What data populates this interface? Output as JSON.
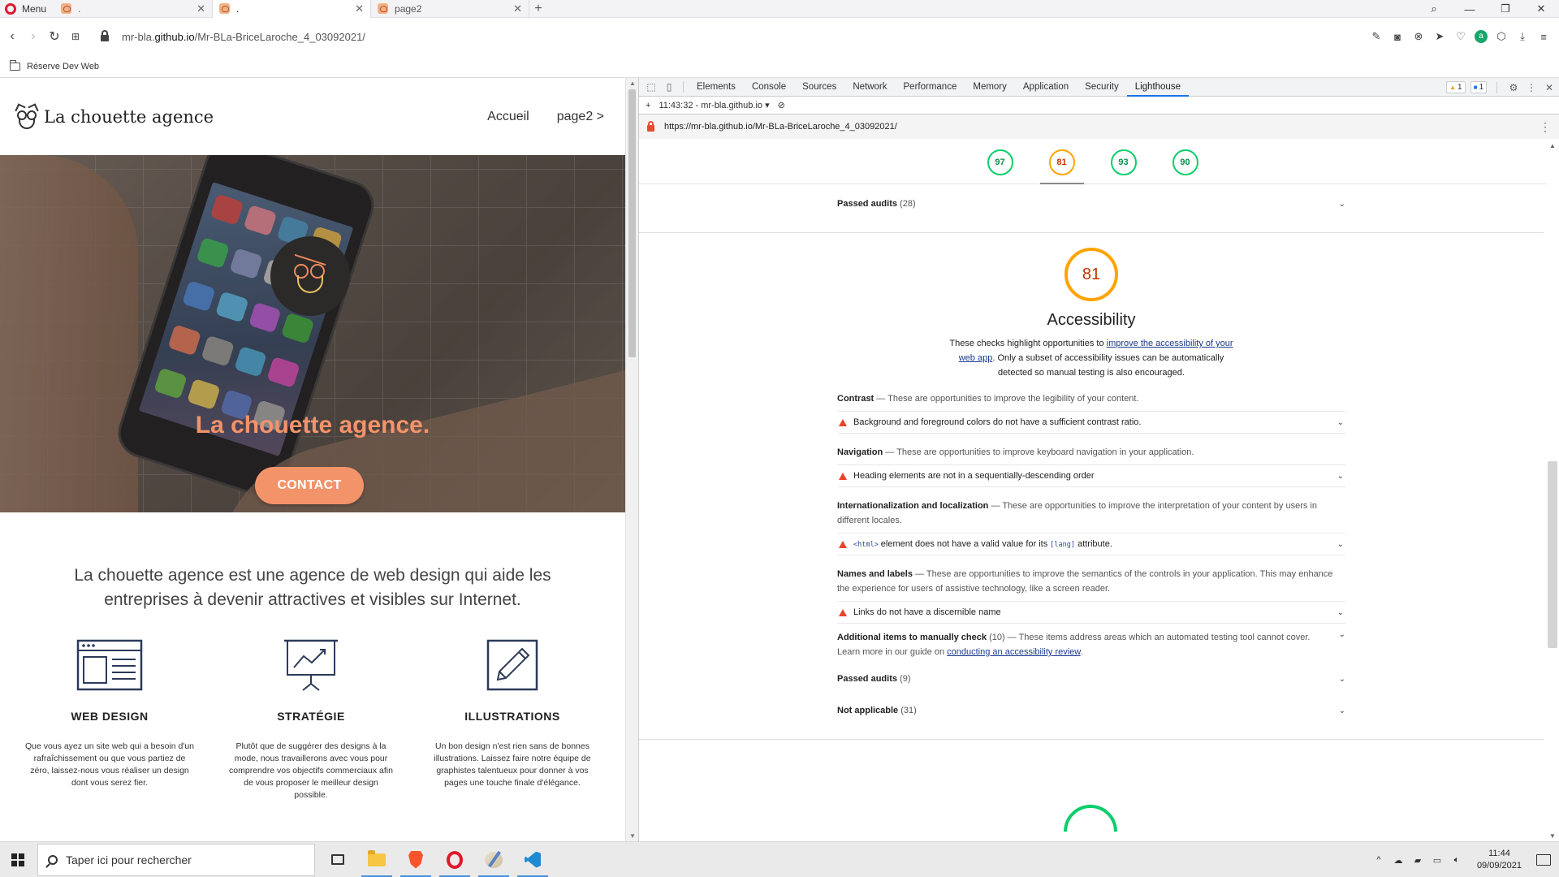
{
  "browser": {
    "menu_label": "Menu",
    "tabs": [
      {
        "title": ".",
        "active": false
      },
      {
        "title": ".",
        "active": true
      },
      {
        "title": "page2",
        "active": false
      }
    ],
    "new_tab": "+",
    "url_prefix": "mr-bla.",
    "url_domain": "github.io",
    "url_path": "/Mr-BLa-BriceLaroche_4_03092021/",
    "bookmark_folder": "Réserve Dev Web"
  },
  "site": {
    "logo_text": "La chouette agence",
    "nav": [
      "Accueil",
      "page2 >"
    ],
    "hero_title": "La chouette agence.",
    "contact_label": "CONTACT",
    "intro": "La chouette agence est une agence de web design qui aide les entreprises à devenir attractives et visibles sur Internet.",
    "services": [
      {
        "title": "WEB DESIGN",
        "text": "Que vous ayez un site web qui a besoin d'un rafraîchissement ou que vous partiez de zéro, laissez-nous vous réaliser un design dont vous serez fier.",
        "icon": "web-design-icon"
      },
      {
        "title": "STRATÉGIE",
        "text": "Plutôt que de suggérer des designs à la mode, nous travaillerons avec vous pour comprendre vos objectifs commerciaux afin de vous proposer le meilleur design possible.",
        "icon": "strategy-chart-icon"
      },
      {
        "title": "ILLUSTRATIONS",
        "text": "Un bon design n'est rien sans de bonnes illustrations. Laissez faire notre équipe de graphistes talentueux pour donner à vos pages une touche finale d'élégance.",
        "icon": "pencil-icon"
      }
    ],
    "accent": "#f3936a"
  },
  "devtools": {
    "tabs": [
      "Elements",
      "Console",
      "Sources",
      "Network",
      "Performance",
      "Memory",
      "Application",
      "Security",
      "Lighthouse"
    ],
    "active_tab": "Lighthouse",
    "warnings": "1",
    "messages": "1",
    "report_selector": "11:43:32 - mr-bla.github.io",
    "report_url": "https://mr-bla.github.io/Mr-BLa-BriceLaroche_4_03092021/",
    "scores": [
      "97",
      "81",
      "93",
      "90"
    ],
    "passed_top": {
      "label": "Passed audits",
      "count": "(28)"
    },
    "accessibility": {
      "score": "81",
      "title": "Accessibility",
      "desc_before": "These checks highlight opportunities to ",
      "desc_link": "improve the accessibility of your web app",
      "desc_after": ". Only a subset of accessibility issues can be automatically detected so manual testing is also encouraged."
    },
    "groups": [
      {
        "title": "Contrast",
        "desc": " — These are opportunities to improve the legibility of your content.",
        "audit": "Background and foreground colors do not have a sufficient contrast ratio."
      },
      {
        "title": "Navigation",
        "desc": " — These are opportunities to improve keyboard navigation in your application.",
        "audit": "Heading elements are not in a sequentially-descending order"
      },
      {
        "title": "Internationalization and localization",
        "desc": " — These are opportunities to improve the interpretation of your content by users in different locales.",
        "audit_code1": "<html>",
        "audit_mid": " element does not have a valid value for its ",
        "audit_code2": "[lang]",
        "audit_end": " attribute."
      },
      {
        "title": "Names and labels",
        "desc": " — These are opportunities to improve the semantics of the controls in your application. This may enhance the experience for users of assistive technology, like a screen reader.",
        "audit": "Links do not have a discernible name"
      }
    ],
    "manual": {
      "title": "Additional items to manually check",
      "count": "(10)",
      "desc": " — These items address areas which an automated testing tool cannot cover. Learn more in our guide on ",
      "link": "conducting an accessibility review",
      "end": "."
    },
    "passed_bottom": {
      "label": "Passed audits",
      "count": "(9)"
    },
    "not_applicable": {
      "label": "Not applicable",
      "count": "(31)"
    },
    "colors": {
      "pass": "#0cce6b",
      "average": "#ffa400",
      "fail": "#e9432b"
    }
  },
  "taskbar": {
    "search_placeholder": "Taper ici pour rechercher",
    "time": "11:44",
    "date": "09/09/2021"
  }
}
